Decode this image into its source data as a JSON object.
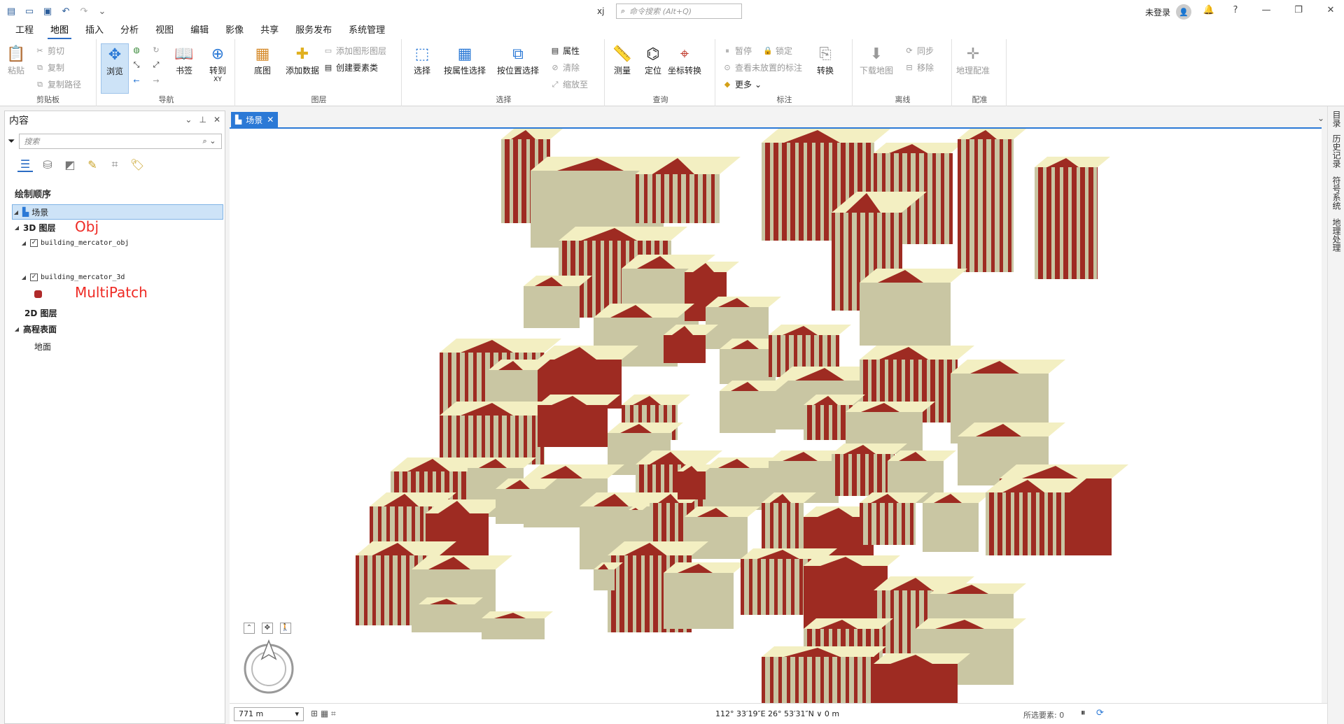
{
  "app": {
    "title": "xj",
    "command_search_placeholder": "命令搜索 (Alt+Q)",
    "user": "未登录",
    "help": "?"
  },
  "ribbon_tabs": [
    "工程",
    "地图",
    "插入",
    "分析",
    "视图",
    "编辑",
    "影像",
    "共享",
    "服务发布",
    "系统管理"
  ],
  "ribbon": {
    "clipboard": {
      "label": "剪贴板",
      "paste": "粘贴",
      "cut": "剪切",
      "copy": "复制",
      "copy_path": "复制路径"
    },
    "navigate": {
      "label": "导航",
      "explore": "浏览",
      "bookmarks": "书签",
      "goto_xy": "转到",
      "goto_xy_sub": "XY"
    },
    "layer": {
      "label": "图层",
      "basemap": "底图",
      "add_data": "添加数据",
      "add_graphics": "添加图形图层",
      "create_feature": "创建要素类"
    },
    "selection": {
      "label": "选择",
      "select": "选择",
      "select_by_attr": "按属性选择",
      "select_by_loc": "按位置选择",
      "attributes": "属性",
      "clear": "清除",
      "zoom_to": "缩放至"
    },
    "inquiry": {
      "label": "查询",
      "measure": "测量",
      "locate": "定位",
      "convert_coords": "坐标转换"
    },
    "labeling": {
      "label": "标注",
      "pause": "暂停",
      "lock": "锁定",
      "view_unplaced": "查看未放置的标注",
      "more": "更多",
      "convert": "转换"
    },
    "offline": {
      "label": "离线",
      "download_map": "下载地图",
      "sync": "同步",
      "remove": "移除"
    },
    "georef": {
      "label": "配准",
      "georeference": "地理配准"
    }
  },
  "contents": {
    "title": "内容",
    "search_placeholder": "搜索",
    "draw_order": "绘制顺序",
    "scene": "场景",
    "layer_3d": "3D 图层",
    "obj_layer": "building_mercator_obj",
    "mp_layer": "building_mercator_3d",
    "layer_2d": "2D 图层",
    "elevation": "高程表面",
    "ground": "地面",
    "annotation_obj": "Obj",
    "annotation_mp": "MultiPatch"
  },
  "map": {
    "tab_name": "场景",
    "scale": "771 m",
    "coordinates": "112° 33′19″E 26° 53′31″N  ∨  0 m",
    "selected_features": "所选要素: 0"
  },
  "side_tabs": [
    "目录",
    "历史记录",
    "符号系统",
    "地理处理"
  ],
  "colors": {
    "roof": "#f3efc2",
    "wall_red": "#9e2b22",
    "wall_beige": "#c9c6a3",
    "accent_blue": "#2b79d6",
    "annotation_red": "#ee2a24"
  }
}
